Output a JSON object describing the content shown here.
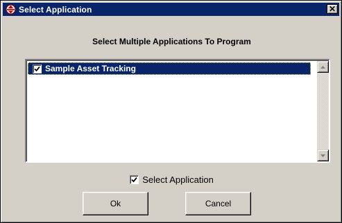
{
  "window": {
    "title": "Select Application",
    "icon": "application-icon",
    "close_icon": "close-icon"
  },
  "heading": "Select Multiple Applications To Program",
  "applications": [
    {
      "label": "Sample Asset Tracking",
      "checked": true,
      "selected": true
    }
  ],
  "select_application": {
    "label": "Select Application",
    "checked": true
  },
  "buttons": {
    "ok": "Ok",
    "cancel": "Cancel"
  },
  "colors": {
    "titlebar": "#0a246a",
    "selection": "#0a246a",
    "face": "#d4d0c8"
  }
}
